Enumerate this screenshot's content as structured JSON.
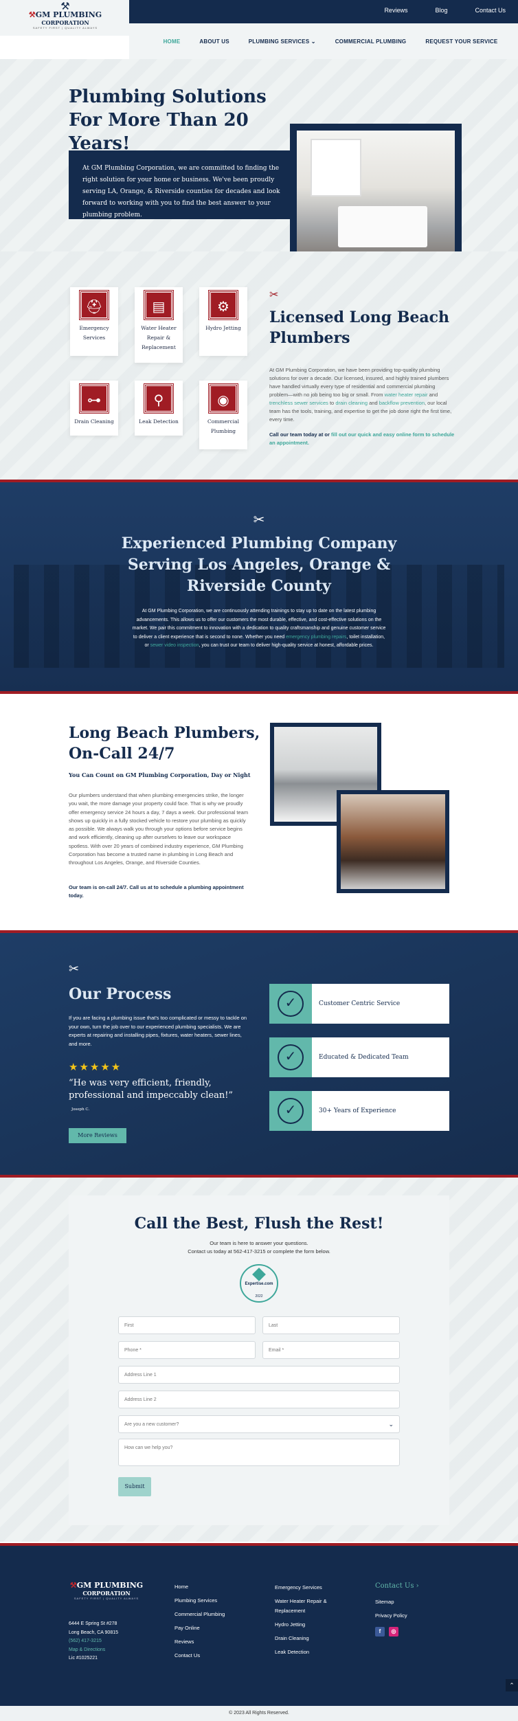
{
  "top_links": [
    "Reviews",
    "Blog",
    "Contact Us"
  ],
  "logo": {
    "brand": "GM PLUMBING",
    "brand_line2": "CORPORATION",
    "tagline": "SAFETY FIRST | QUALITY ALWAYS"
  },
  "nav": [
    "HOME",
    "ABOUT US",
    "PLUMBING SERVICES ⌄",
    "COMMERCIAL PLUMBING",
    "REQUEST YOUR SERVICE"
  ],
  "hero": {
    "title": "Plumbing Solutions For More Than 20 Years!",
    "text": "At GM Plumbing Corporation, we are committed to finding the right solution for your home or business. We've been proudly serving LA, Orange, & Riverside counties for decades and look forward to working with you to find the best answer to your plumbing problem."
  },
  "services": [
    {
      "label": "Emergency Services",
      "icon": "emergency-icon"
    },
    {
      "label": "Water Heater Repair & Replacement",
      "icon": "water-heater-icon"
    },
    {
      "label": "Hydro Jetting",
      "icon": "hydro-jetting-icon"
    },
    {
      "label": "Drain Cleaning",
      "icon": "drain-cleaning-icon"
    },
    {
      "label": "Leak Detection",
      "icon": "leak-detection-icon"
    },
    {
      "label": "Commercial Plumbing",
      "icon": "commercial-plumbing-icon"
    }
  ],
  "licensed": {
    "title": "Licensed Long Beach Plumbers",
    "p1_a": "At GM Plumbing Corporation, we have been providing top-quality plumbing solutions for over a decade. Our licensed, insured, and highly trained plumbers have handled virtually every type of residential and commercial plumbing problem—with no job being too big or small. From ",
    "link1": "water heater repair",
    "p1_b": " and ",
    "link2": "trenchless sewer services",
    "p1_c": " to ",
    "link3": "drain cleaning",
    "p1_d": " and ",
    "link4": "backflow prevention",
    "p1_e": ", our local team has the tools, training, and expertise to get the job done right the first time, every time.",
    "cta_a": "Call our team today at or ",
    "cta_link": "fill out our quick and easy online form to schedule an appointment."
  },
  "experienced": {
    "title": "Experienced Plumbing Company Serving Los Angeles, Orange & Riverside County",
    "text_a": "At GM Plumbing Corporation, we are continuously attending trainings to stay up to date on the latest plumbing advancements. This allows us to offer our customers the most durable, effective, and cost-effective solutions on the market. We pair this commitment to innovation with a dedication to quality craftsmanship and genuine customer service to deliver a client experience that is second to none. Whether you need ",
    "link1": "emergency plumbing repairs",
    "text_b": ", toilet installation, or ",
    "link2": "sewer video inspection",
    "text_c": ", you can trust our team to deliver high-quality service at honest, affordable prices."
  },
  "long_beach": {
    "title": "Long Beach Plumbers, On-Call 24/7",
    "subtitle": "You Can Count on GM Plumbing Corporation, Day or Night",
    "text": "Our plumbers understand that when plumbing emergencies strike, the longer you wait, the more damage your property could face. That is why we proudly offer emergency service 24 hours a day, 7 days a week. Our professional team shows up quickly in a fully stocked vehicle to restore your plumbing as quickly as possible. We always walk you through your options before service begins and work efficiently, cleaning up after ourselves to leave our workspace spotless. With over 20 years of combined industry experience, GM Plumbing Corporation has become a trusted name in plumbing in Long Beach and throughout Los Angeles, Orange, and Riverside Counties.",
    "cta": "Our team is on-call 24/7. Call us at to schedule a plumbing appointment today."
  },
  "process": {
    "title": "Our Process",
    "text": "If you are facing a plumbing issue that's too complicated or messy to tackle on your own, turn the job over to our experienced plumbing specialists. We are experts at repairing and installing pipes, fixtures, water heaters, sewer lines, and more.",
    "stars": "★★★★★",
    "quote": "“He was very efficient, friendly, professional and impeccably clean!”",
    "author": "Joseph C.",
    "button": "More Reviews",
    "features": [
      "Customer Centric Service",
      "Educated & Dedicated Team",
      "30+ Years of Experience"
    ]
  },
  "contact": {
    "title": "Call the Best, Flush the Rest!",
    "sub1": "Our team is here to answer your questions.",
    "sub2": "Contact us today at 562-417-3215 or complete the form below.",
    "badge_name": "Expertise.com",
    "badge_year": "2022",
    "fields": {
      "first": "First",
      "last": "Last",
      "phone": "Phone *",
      "email": "Email *",
      "address1": "Address Line 1",
      "address2": "Address Line 2",
      "customer": "Are you a new customer?",
      "message": "How can we help you?"
    },
    "submit": "Submit"
  },
  "footer": {
    "address1": "6444 E Spring St #278",
    "address2": "Long Beach, CA 90815",
    "phone": "(562) 417-3215",
    "map": "Map & Directions",
    "license": "Lic #1025221",
    "col1": [
      "Home",
      "Plumbing Services",
      "Commercial Plumbing",
      "Pay Online",
      "Reviews",
      "Contact Us"
    ],
    "col2": [
      "Emergency Services",
      "Water Heater Repair & Replacement",
      "Hydro Jetting",
      "Drain Cleaning",
      "Leak Detection"
    ],
    "contact_heading": "Contact Us ›",
    "col3": [
      "Sitemap",
      "Privacy Policy"
    ],
    "social": [
      "f",
      "◎"
    ],
    "copyright": "© 2023 All Rights Reserved."
  },
  "colors": {
    "navy": "#142b4d",
    "red": "#a01c24",
    "teal": "#3ea79a",
    "light_teal": "#62b8ab"
  }
}
